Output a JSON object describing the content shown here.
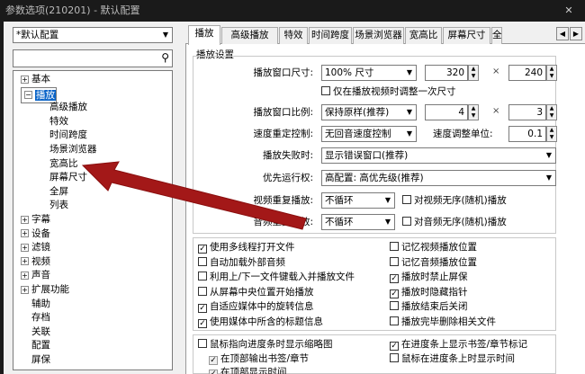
{
  "window": {
    "title": "参数选项(210201) - 默认配置",
    "close": "✕"
  },
  "sidebar": {
    "preset": "*默认配置",
    "tree": [
      {
        "label": "基本",
        "exp": "+"
      },
      {
        "label": "播放",
        "exp": "−"
      },
      {
        "label": "高级播放"
      },
      {
        "label": "特效"
      },
      {
        "label": "时间跨度"
      },
      {
        "label": "场景浏览器"
      },
      {
        "label": "宽高比"
      },
      {
        "label": "屏幕尺寸"
      },
      {
        "label": "全屏"
      },
      {
        "label": "列表"
      },
      {
        "label": "字幕",
        "exp": "+"
      },
      {
        "label": "设备",
        "exp": "+"
      },
      {
        "label": "滤镜",
        "exp": "+"
      },
      {
        "label": "视频",
        "exp": "+"
      },
      {
        "label": "声音",
        "exp": "+"
      },
      {
        "label": "扩展功能",
        "exp": "+"
      },
      {
        "label": "辅助"
      },
      {
        "label": "存档"
      },
      {
        "label": "关联"
      },
      {
        "label": "配置"
      },
      {
        "label": "屏保"
      }
    ]
  },
  "tabs": [
    "播放",
    "高级播放",
    "特效",
    "时间跨度",
    "场景浏览器",
    "宽高比",
    "屏幕尺寸",
    "全"
  ],
  "nav": {
    "left": "◀",
    "right": "▶"
  },
  "settings": {
    "group_title": "播放设置",
    "window_size_label": "播放窗口尺寸:",
    "window_size_value": "100% 尺寸",
    "width": "320",
    "height": "240",
    "times": "×",
    "adjust_once": "仅在播放视频时调整一次尺寸",
    "ratio_label": "播放窗口比例:",
    "ratio_value": "保持原样(推荐)",
    "ratio_a": "4",
    "ratio_b": "3",
    "speed_label": "速度重定控制:",
    "speed_value": "无回音速度控制",
    "speed_unit_label": "速度调整单位:",
    "speed_unit_value": "0.1",
    "dropframe_label": "播放失败时:",
    "dropframe_value": "显示错误窗口(推荐)",
    "priority_label": "优先运行权:",
    "priority_value": "高配置: 高优先级(推荐)",
    "video_repeat_label": "视频重复播放:",
    "video_repeat_value": "不循环",
    "video_random": "对视频无序(随机)播放",
    "audio_repeat_label": "音频重复播放:",
    "audio_repeat_value": "不循环",
    "audio_random": "对音频无序(随机)播放"
  },
  "checks_left": [
    {
      "label": "使用多线程打开文件",
      "on": true
    },
    {
      "label": "自动加载外部音频",
      "on": false
    },
    {
      "label": "利用上/下一文件键载入并播放文件",
      "on": false
    },
    {
      "label": "从屏幕中央位置开始播放",
      "on": false
    },
    {
      "label": "自适应媒体中的旋转信息",
      "on": true
    },
    {
      "label": "使用媒体中所含的标题信息",
      "on": true
    }
  ],
  "checks_right": [
    {
      "label": "记忆视频播放位置",
      "on": false
    },
    {
      "label": "记忆音频播放位置",
      "on": false
    },
    {
      "label": "播放时禁止屏保",
      "on": true
    },
    {
      "label": "播放时隐藏指针",
      "on": true
    },
    {
      "label": "播放结束后关闭",
      "on": false
    },
    {
      "label": "播放完毕删除相关文件",
      "on": false
    }
  ],
  "bottom": {
    "thumb": "鼠标指向进度条时显示缩略图",
    "bookmark": "在进度条上显示书签/章节标记",
    "top_output": "在顶部输出书签/章节",
    "mouse_time": "鼠标在进度条上时显示时间",
    "top_time": "在顶部显示时间"
  },
  "colors": {
    "accent": "#0a64c8",
    "arrow": "#a31818"
  }
}
